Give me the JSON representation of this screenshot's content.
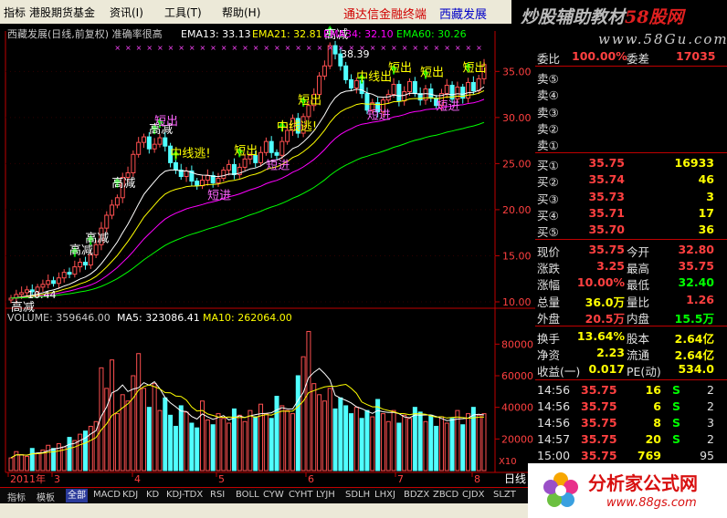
{
  "menu": {
    "items": [
      "指标",
      "港股期货基金",
      "资讯(I)",
      "工具(T)",
      "帮助(H)"
    ],
    "promo": "通达信金融终端",
    "stock": "西藏发展"
  },
  "banner": {
    "title_prefix": "炒股辅助教材",
    "title_site": "58股网",
    "url": "www.58Gu.com"
  },
  "main_chart": {
    "legend_title": "西藏发展(日线,前复权) 准确率很高",
    "ema13": "EMA13: 33.13",
    "ema21": "EMA21: 32.81",
    "ema34": "EMA34: 32.10",
    "ema60": "EMA60: 30.26",
    "y_ticks": [
      "35.00",
      "30.00",
      "25.00",
      "20.00",
      "15.00",
      "10.00"
    ],
    "high_label": "38.39",
    "low_label": "10.44",
    "annotations": {
      "gao_jian": "高减",
      "duan_chu": "短出",
      "duan_jin": "短进",
      "zhong_xian_tao": "中线逃!",
      "zhong_xian_chu": "中线出"
    }
  },
  "volume_chart": {
    "legend_volume": "VOLUME: 359646.00",
    "legend_ma5": "MA5: 323086.41",
    "legend_ma10": "MA10: 262064.00",
    "y_ticks": [
      "80000",
      "60000",
      "40000",
      "20000"
    ],
    "unit": "X10"
  },
  "date_axis": {
    "labels": [
      "2011年",
      "3",
      "4",
      "5",
      "6",
      "7",
      "8"
    ],
    "period": "日线"
  },
  "quote_panel": {
    "weibi_label": "委比",
    "weibi_value": "100.00%",
    "weicha_label": "委差",
    "weicha_value": "17035",
    "asks": [
      {
        "label": "卖⑤",
        "price": "",
        "vol": ""
      },
      {
        "label": "卖④",
        "price": "",
        "vol": ""
      },
      {
        "label": "卖③",
        "price": "",
        "vol": ""
      },
      {
        "label": "卖②",
        "price": "",
        "vol": ""
      },
      {
        "label": "卖①",
        "price": "",
        "vol": ""
      }
    ],
    "bids": [
      {
        "label": "买①",
        "price": "35.75",
        "vol": "16933"
      },
      {
        "label": "买②",
        "price": "35.74",
        "vol": "46"
      },
      {
        "label": "买③",
        "price": "35.73",
        "vol": "3"
      },
      {
        "label": "买④",
        "price": "35.71",
        "vol": "17"
      },
      {
        "label": "买⑤",
        "price": "35.70",
        "vol": "36"
      }
    ],
    "stats": [
      {
        "l1": "现价",
        "v1": "35.75",
        "l2": "今开",
        "v2": "32.80"
      },
      {
        "l1": "涨跌",
        "v1": "3.25",
        "l2": "最高",
        "v2": "35.75"
      },
      {
        "l1": "涨幅",
        "v1": "10.00%",
        "l2": "最低",
        "v2": "32.40"
      },
      {
        "l1": "总量",
        "v1": "36.0万",
        "l2": "量比",
        "v2": "1.26"
      },
      {
        "l1": "外盘",
        "v1": "20.5万",
        "l2": "内盘",
        "v2": "15.5万"
      }
    ],
    "stats2": [
      {
        "l1": "换手",
        "v1": "13.64%",
        "l2": "股本",
        "v2": "2.64亿"
      },
      {
        "l1": "净资",
        "v1": "2.23",
        "l2": "流通",
        "v2": "2.64亿"
      },
      {
        "l1": "收益(一)",
        "v1": "0.017",
        "l2": "PE(动)",
        "v2": "534.0"
      }
    ],
    "ticks": [
      {
        "time": "14:56",
        "price": "35.75",
        "vol": "16",
        "side": "S",
        "n": "2"
      },
      {
        "time": "14:56",
        "price": "35.75",
        "vol": "6",
        "side": "S",
        "n": "2"
      },
      {
        "time": "14:56",
        "price": "35.75",
        "vol": "8",
        "side": "S",
        "n": "3"
      },
      {
        "time": "14:57",
        "price": "35.75",
        "vol": "20",
        "side": "S",
        "n": "2"
      },
      {
        "time": "15:00",
        "price": "35.75",
        "vol": "769",
        "side": "",
        "n": "95"
      }
    ]
  },
  "tabs": [
    "指标",
    "模板",
    "全部",
    "MACD",
    "KDJ",
    "KD",
    "KDJ-TDX",
    "RSI",
    "BOLL",
    "CYW",
    "CYHT",
    "LYJH",
    "SDLH",
    "LHXJ",
    "BDZX",
    "ZBCD",
    "CJDX",
    "SLZT"
  ],
  "watermark": {
    "name": "分析家公式网",
    "url": "www.88gs.com"
  },
  "colors": {
    "bg": "#000000",
    "up": "#ff5050",
    "down": "#50ffff",
    "ema13": "#ffffff",
    "ema21": "#ffff00",
    "ema34": "#ff00ff",
    "ema60": "#00ff00",
    "grid": "#c00000",
    "axis_text": "#ff4040"
  },
  "chart_data": {
    "type": "line",
    "price_series": [
      10.4,
      10.8,
      11.0,
      11.3,
      11.1,
      11.6,
      11.9,
      12.3,
      12.0,
      12.6,
      13.2,
      13.0,
      13.8,
      14.3,
      14.0,
      15.1,
      16.2,
      18.0,
      19.4,
      20.5,
      21.3,
      23.5,
      24.0,
      26.0,
      27.3,
      27.9,
      26.6,
      27.1,
      27.8,
      26.9,
      25.1,
      24.3,
      23.6,
      24.2,
      23.1,
      22.6,
      23.2,
      23.7,
      22.9,
      23.4,
      24.3,
      24.9,
      23.8,
      24.6,
      25.5,
      25.9,
      25.1,
      26.2,
      27.4,
      26.2,
      25.9,
      27.4,
      28.6,
      29.9,
      28.3,
      30.1,
      31.3,
      32.5,
      34.5,
      35.6,
      37.8,
      36.9,
      35.6,
      34.1,
      33.2,
      34.0,
      32.6,
      30.8,
      31.6,
      30.6,
      31.9,
      32.5,
      33.6,
      31.8,
      32.8,
      33.9,
      32.6,
      31.9,
      33.1,
      32.1,
      31.3,
      32.6,
      33.5,
      32.0,
      33.3,
      32.1,
      33.8,
      32.9,
      34.2,
      35.75
    ],
    "volume_series": [
      8,
      12,
      10,
      9,
      14,
      11,
      13,
      16,
      14,
      17,
      15,
      21,
      19,
      23,
      25,
      28,
      31,
      65,
      52,
      70,
      36,
      48,
      44,
      60,
      74,
      52,
      40,
      55,
      38,
      46,
      35,
      28,
      41,
      37,
      30,
      27,
      44,
      32,
      29,
      36,
      33,
      30,
      39,
      35,
      31,
      38,
      34,
      42,
      36,
      33,
      47,
      41,
      38,
      36,
      60,
      72,
      88,
      55,
      48,
      44,
      52,
      39,
      46,
      41,
      36,
      40,
      33,
      38,
      34,
      45,
      36,
      31,
      38,
      30,
      35,
      33,
      40,
      37,
      31,
      35,
      28,
      34,
      30,
      33,
      38,
      29,
      36,
      40,
      35,
      36
    ],
    "ylim": [
      10,
      38
    ],
    "volume_ylim": [
      0,
      90000
    ]
  }
}
